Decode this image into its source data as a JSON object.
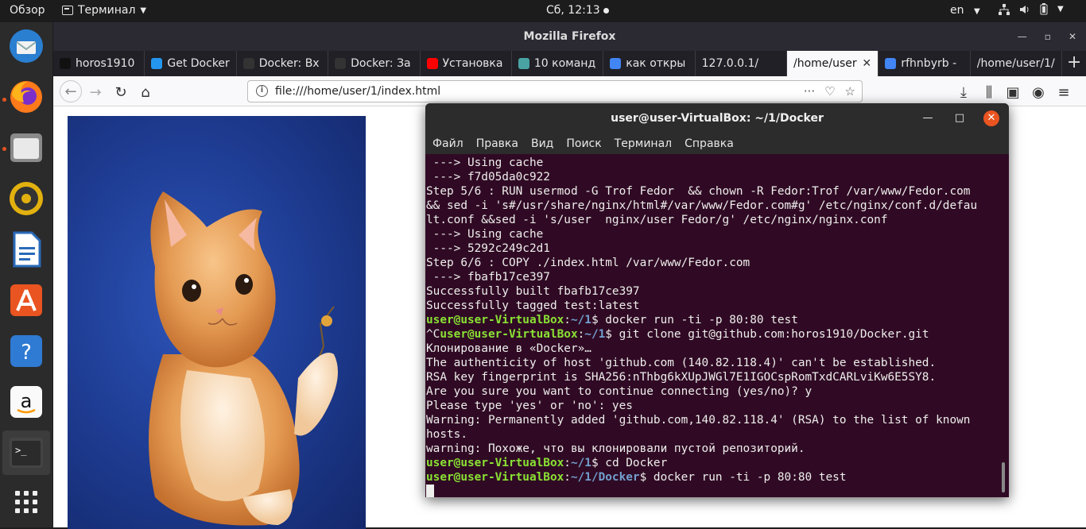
{
  "topbar": {
    "activities": "Обзор",
    "app_menu": "Терминал",
    "clock": "Сб, 12:13",
    "language": "en"
  },
  "dock": {
    "items": [
      "thunderbird-icon",
      "firefox-icon",
      "files-icon",
      "rhythmbox-icon",
      "libreoffice-writer-icon",
      "ubuntu-software-icon",
      "help-icon",
      "amazon-icon",
      "terminal-icon",
      "show-applications-icon"
    ],
    "accent": "#e95420"
  },
  "firefox": {
    "title": "Mozilla Firefox",
    "tabs": [
      {
        "label": "horos1910",
        "icon": "github-icon",
        "color": "#111111"
      },
      {
        "label": "Get Docker",
        "icon": "docker-icon",
        "color": "#2496ed"
      },
      {
        "label": "Docker: Вх",
        "icon": "habr-icon",
        "color": "#333333"
      },
      {
        "label": "Docker: За",
        "icon": "habr-icon",
        "color": "#333333"
      },
      {
        "label": "Установка",
        "icon": "youtube-icon",
        "color": "#ff0000"
      },
      {
        "label": "10 команд",
        "icon": "site-icon",
        "color": "#4aa3a3"
      },
      {
        "label": "как откры",
        "icon": "google-icon",
        "color": "#4285f4"
      },
      {
        "label": "127.0.0.1/",
        "icon": "",
        "color": ""
      },
      {
        "label": "/home/user",
        "icon": "",
        "color": "",
        "active": true
      },
      {
        "label": "rfhnbyrb -",
        "icon": "google-icon",
        "color": "#4285f4"
      },
      {
        "label": "/home/user/1/",
        "icon": "",
        "color": ""
      }
    ],
    "url": "file:///home/user/1/index.html"
  },
  "terminal": {
    "title": "user@user-VirtualBox: ~/1/Docker",
    "menu": [
      "Файл",
      "Правка",
      "Вид",
      "Поиск",
      "Терминал",
      "Справка"
    ],
    "lines": [
      {
        "text": " ---> Using cache"
      },
      {
        "text": " ---> f7d05da0c922"
      },
      {
        "text": "Step 5/6 : RUN usermod -G Trof Fedor  && chown -R Fedor:Trof /var/www/Fedor.com"
      },
      {
        "text": "&& sed -i 's#/usr/share/nginx/html#/var/www/Fedor.com#g' /etc/nginx/conf.d/defau"
      },
      {
        "text": "lt.conf &&sed -i 's/user  nginx/user Fedor/g' /etc/nginx/nginx.conf"
      },
      {
        "text": " ---> Using cache"
      },
      {
        "text": " ---> 5292c249c2d1"
      },
      {
        "text": "Step 6/6 : COPY ./index.html /var/www/Fedor.com"
      },
      {
        "text": " ---> fbafb17ce397"
      },
      {
        "text": "Successfully built fbafb17ce397"
      },
      {
        "text": "Successfully tagged test:latest"
      },
      {
        "pre": "",
        "user": "user@user-VirtualBox",
        "path": "~/1",
        "cmd": "$ docker run -ti -p 80:80 test"
      },
      {
        "pre": "^C",
        "user": "user@user-VirtualBox",
        "path": "~/1",
        "cmd": "$ git clone git@github.com:horos1910/Docker.git"
      },
      {
        "text": "Клонирование в «Docker»…"
      },
      {
        "text": "The authenticity of host 'github.com (140.82.118.4)' can't be established."
      },
      {
        "text": "RSA key fingerprint is SHA256:nThbg6kXUpJWGl7E1IGOCspRomTxdCARLviKw6E5SY8."
      },
      {
        "text": "Are you sure you want to continue connecting (yes/no)? y"
      },
      {
        "text": "Please type 'yes' or 'no': yes"
      },
      {
        "text": "Warning: Permanently added 'github.com,140.82.118.4' (RSA) to the list of known"
      },
      {
        "text": "hosts."
      },
      {
        "text": "warning: Похоже, что вы клонировали пустой репозиторий."
      },
      {
        "pre": "",
        "user": "user@user-VirtualBox",
        "path": "~/1",
        "cmd": "$ cd Docker"
      },
      {
        "pre": "",
        "user": "user@user-VirtualBox",
        "path": "~/1/Docker",
        "cmd": "$ docker run -ti -p 80:80 test"
      }
    ],
    "colors": {
      "background": "#300a24",
      "user": "#8ae234",
      "path": "#729fcf"
    }
  }
}
